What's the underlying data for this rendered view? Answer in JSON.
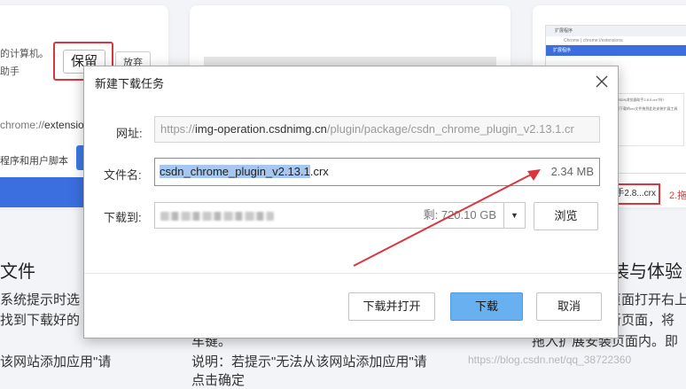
{
  "background": {
    "left_card": {
      "text_line1": "的计算机。",
      "text_line2": "助手",
      "keep_button": "保留",
      "discard_button": "放弃",
      "url_prefix": "chrome://",
      "url_rest": "extensio",
      "scripts_text": "程序和用户脚本"
    },
    "right_card": {
      "tab_title": "扩展程序",
      "address": "Chrome | chrome://extensions",
      "header": "扩展程序",
      "popup_line1": "将CSDN浏览器助手2.8.0.crx\"吗?",
      "popup_line2": "请将下载的crx文件拖到此处安装扩展工具",
      "crx_label": "手2.8...crx",
      "step_label": "2.拖"
    },
    "heading_left": "文件",
    "heading_right": "装与体验",
    "lines_left": [
      "系统提示时选",
      "找到下载好的",
      "该网站添加应用\"请"
    ],
    "lines_mid": [
      "车键。",
      "说明：若提示\"无法从该网站添加应用\"请",
      "点击确定"
    ],
    "lines_right": [
      "页面打开右上",
      "新页面，将",
      "拖入扩展安装页面内。即"
    ],
    "watermark": "https://blog.csdn.net/qq_38722360"
  },
  "dialog": {
    "title": "新建下载任务",
    "url_label": "网址:",
    "url_scheme": "https://",
    "url_domain": "img-operation.csdnimg.cn",
    "url_path": "/plugin/package/csdn_chrome_plugin_v2.13.1.cr",
    "name_label": "文件名:",
    "filename_base": "csdn_chrome_plugin_v2.13.1",
    "filename_ext": ".crx",
    "file_size": "2.34 MB",
    "dest_label": "下载到:",
    "free_space": "剩: 720.10 GB",
    "dropdown_glyph": "▼",
    "browse_button": "浏览",
    "download_open_button": "下载并打开",
    "download_button": "下载",
    "cancel_button": "取消"
  },
  "colors": {
    "annotation_red": "#d9363e",
    "primary_button": "#68b0f0",
    "selection": "#a7c7f0"
  }
}
